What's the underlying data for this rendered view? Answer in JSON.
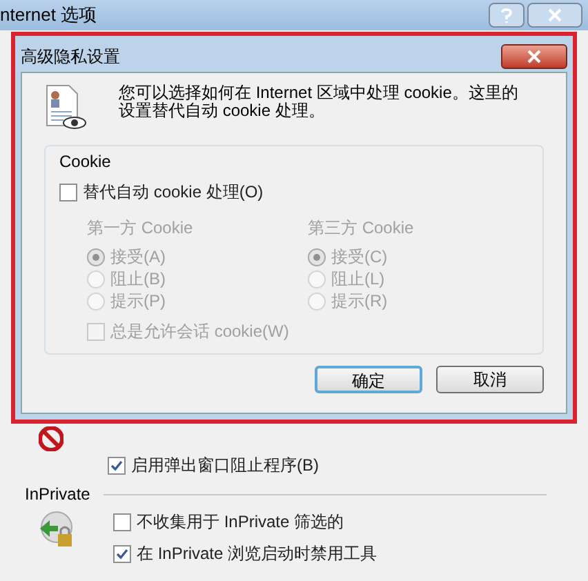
{
  "window": {
    "title": "nternet 选项"
  },
  "dialog": {
    "title": "高级隐私设置",
    "description": "您可以选择如何在 Internet 区域中处理 cookie。这里的设置替代自动 cookie 处理。",
    "group": {
      "title": "Cookie",
      "override": {
        "label": "替代自动 cookie 处理(O)",
        "checked": false
      },
      "columns": [
        {
          "title": "第一方 Cookie",
          "options": [
            {
              "label": "接受(A)",
              "selected": true
            },
            {
              "label": "阻止(B)",
              "selected": false
            },
            {
              "label": "提示(P)",
              "selected": false
            }
          ]
        },
        {
          "title": "第三方 Cookie",
          "options": [
            {
              "label": "接受(C)",
              "selected": true
            },
            {
              "label": "阻止(L)",
              "selected": false
            },
            {
              "label": "提示(R)",
              "selected": false
            }
          ]
        }
      ],
      "session": {
        "label": "总是允许会话 cookie(W)",
        "checked": false,
        "disabled": true
      }
    },
    "buttons": [
      {
        "label": "确定",
        "kind": "default"
      },
      {
        "label": "取消",
        "kind": "normal"
      }
    ]
  },
  "popup": {
    "label": "启用弹出窗口阻止程序(B)",
    "checked": true
  },
  "inprivate": {
    "title": "InPrivate",
    "options": [
      {
        "label": "不收集用于 InPrivate 筛选的",
        "checked": false
      },
      {
        "label": "在 InPrivate 浏览启动时禁用工具",
        "checked": true
      }
    ]
  }
}
